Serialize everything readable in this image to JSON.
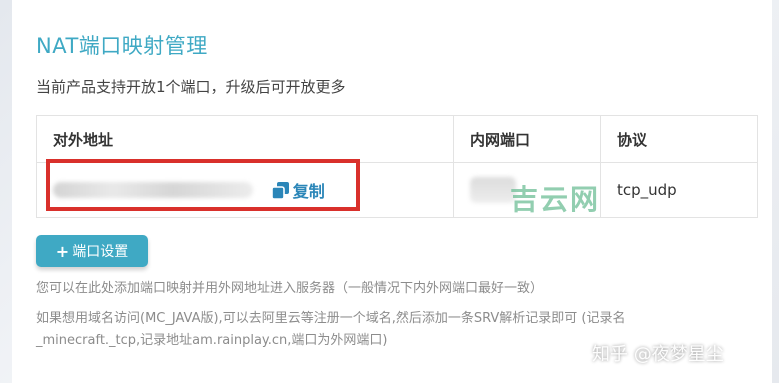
{
  "page": {
    "title": "NAT端口映射管理",
    "subtitle": "当前产品支持开放1个端口，升级后可开放更多"
  },
  "table": {
    "headers": [
      "对外地址",
      "内网端口",
      "协议"
    ],
    "rows": [
      {
        "address": "",
        "port": "",
        "protocol": "tcp_udp"
      }
    ],
    "copy_label": "复制"
  },
  "port_settings_button": "端口设置",
  "help": {
    "line1": "您可以在此处添加端口映射并用外网地址进入服务器（一般情况下内外网端口最好一致）",
    "line2": "如果想用域名访问(MC_JAVA版),可以去阿里云等注册一个域名,然后添加一条SRV解析记录即可 (记录名_minecraft._tcp,记录地址am.rainplay.cn,端口为外网端口)"
  },
  "overlay_watermark": "吉云网",
  "watermark": "知乎 @夜梦星尘",
  "icons": {
    "copy": "copy-icon",
    "plus": "plus-icon"
  },
  "colors": {
    "accent": "#3fa9c4",
    "link": "#2b86b8",
    "highlight_box": "#d9302b"
  }
}
